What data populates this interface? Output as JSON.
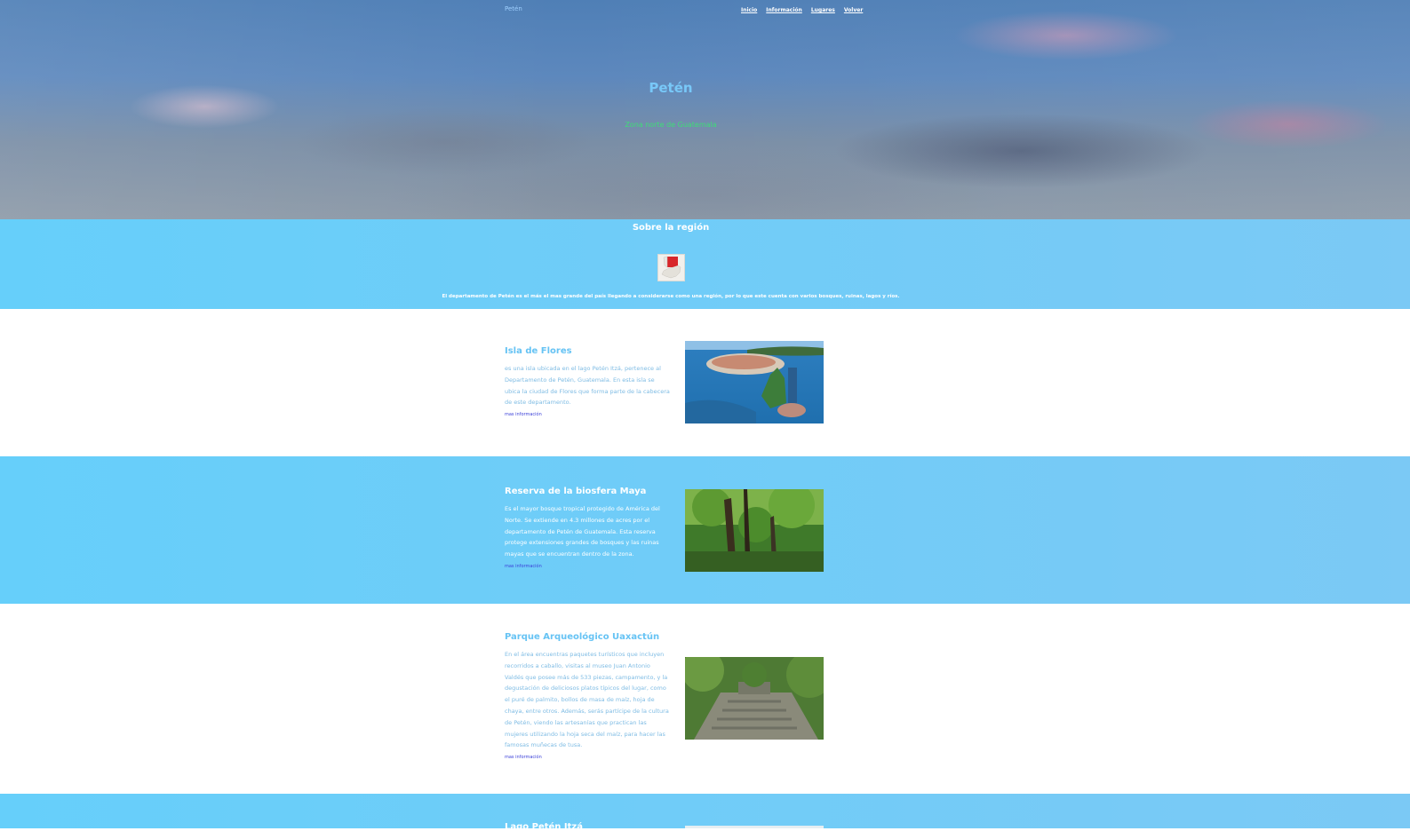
{
  "header": {
    "brand": "Petén",
    "nav": [
      "Inicio",
      "Información",
      "Lugares",
      "Volver"
    ]
  },
  "hero": {
    "title": "Petén",
    "subtitle": "Zona norte de Guatemala"
  },
  "about": {
    "title": "Sobre la región",
    "text": "El departamento de Petén es el más el mas grande del país llegando a considerarse como una región, por lo que este cuenta con varios bosques, ruinas, lagos y ríos."
  },
  "places": [
    {
      "title": "Isla de Flores",
      "body": "es una isla ubicada en el lago Petén Itzá, pertenece al Departamento de Petén, Guatemala. En esta isla se ubica la ciudad de Flores que forma parte de la cabecera de este departamento.",
      "link": "mas información"
    },
    {
      "title": "Reserva de la biosfera Maya",
      "body": "Es el mayor bosque tropical protegido de América del Norte. Se extiende en 4.3 millones de acres por el departamento de Petén de Guatemala. Esta reserva protege extensiones grandes de bosques y las ruinas mayas que se encuentran dentro de la zona.",
      "link": "mas información"
    },
    {
      "title": "Parque Arqueológico Uaxactún",
      "body": "En el área encuentras paquetes turísticos que incluyen recorridos a caballo, visitas al museo Juan Antonio Valdés que posee más de 533 piezas, campamento, y la degustación de deliciosos platos típicos del lugar, como el puré de palmito, bollos de masa de maíz, hoja de chaya, entre otros. Además, serás partícipe de la cultura de Petén, viendo las artesanías que practican las mujeres utilizando la hoja seca del maíz, para hacer las famosas muñecas de tusa.",
      "link": "mas información"
    },
    {
      "title": "Lago Petén Itzá"
    }
  ],
  "colors": {
    "accent_blue": "#66cffa",
    "title_blue": "#78c8f8",
    "subtitle_green": "#3fdc78",
    "link": "#3a3fd8"
  }
}
